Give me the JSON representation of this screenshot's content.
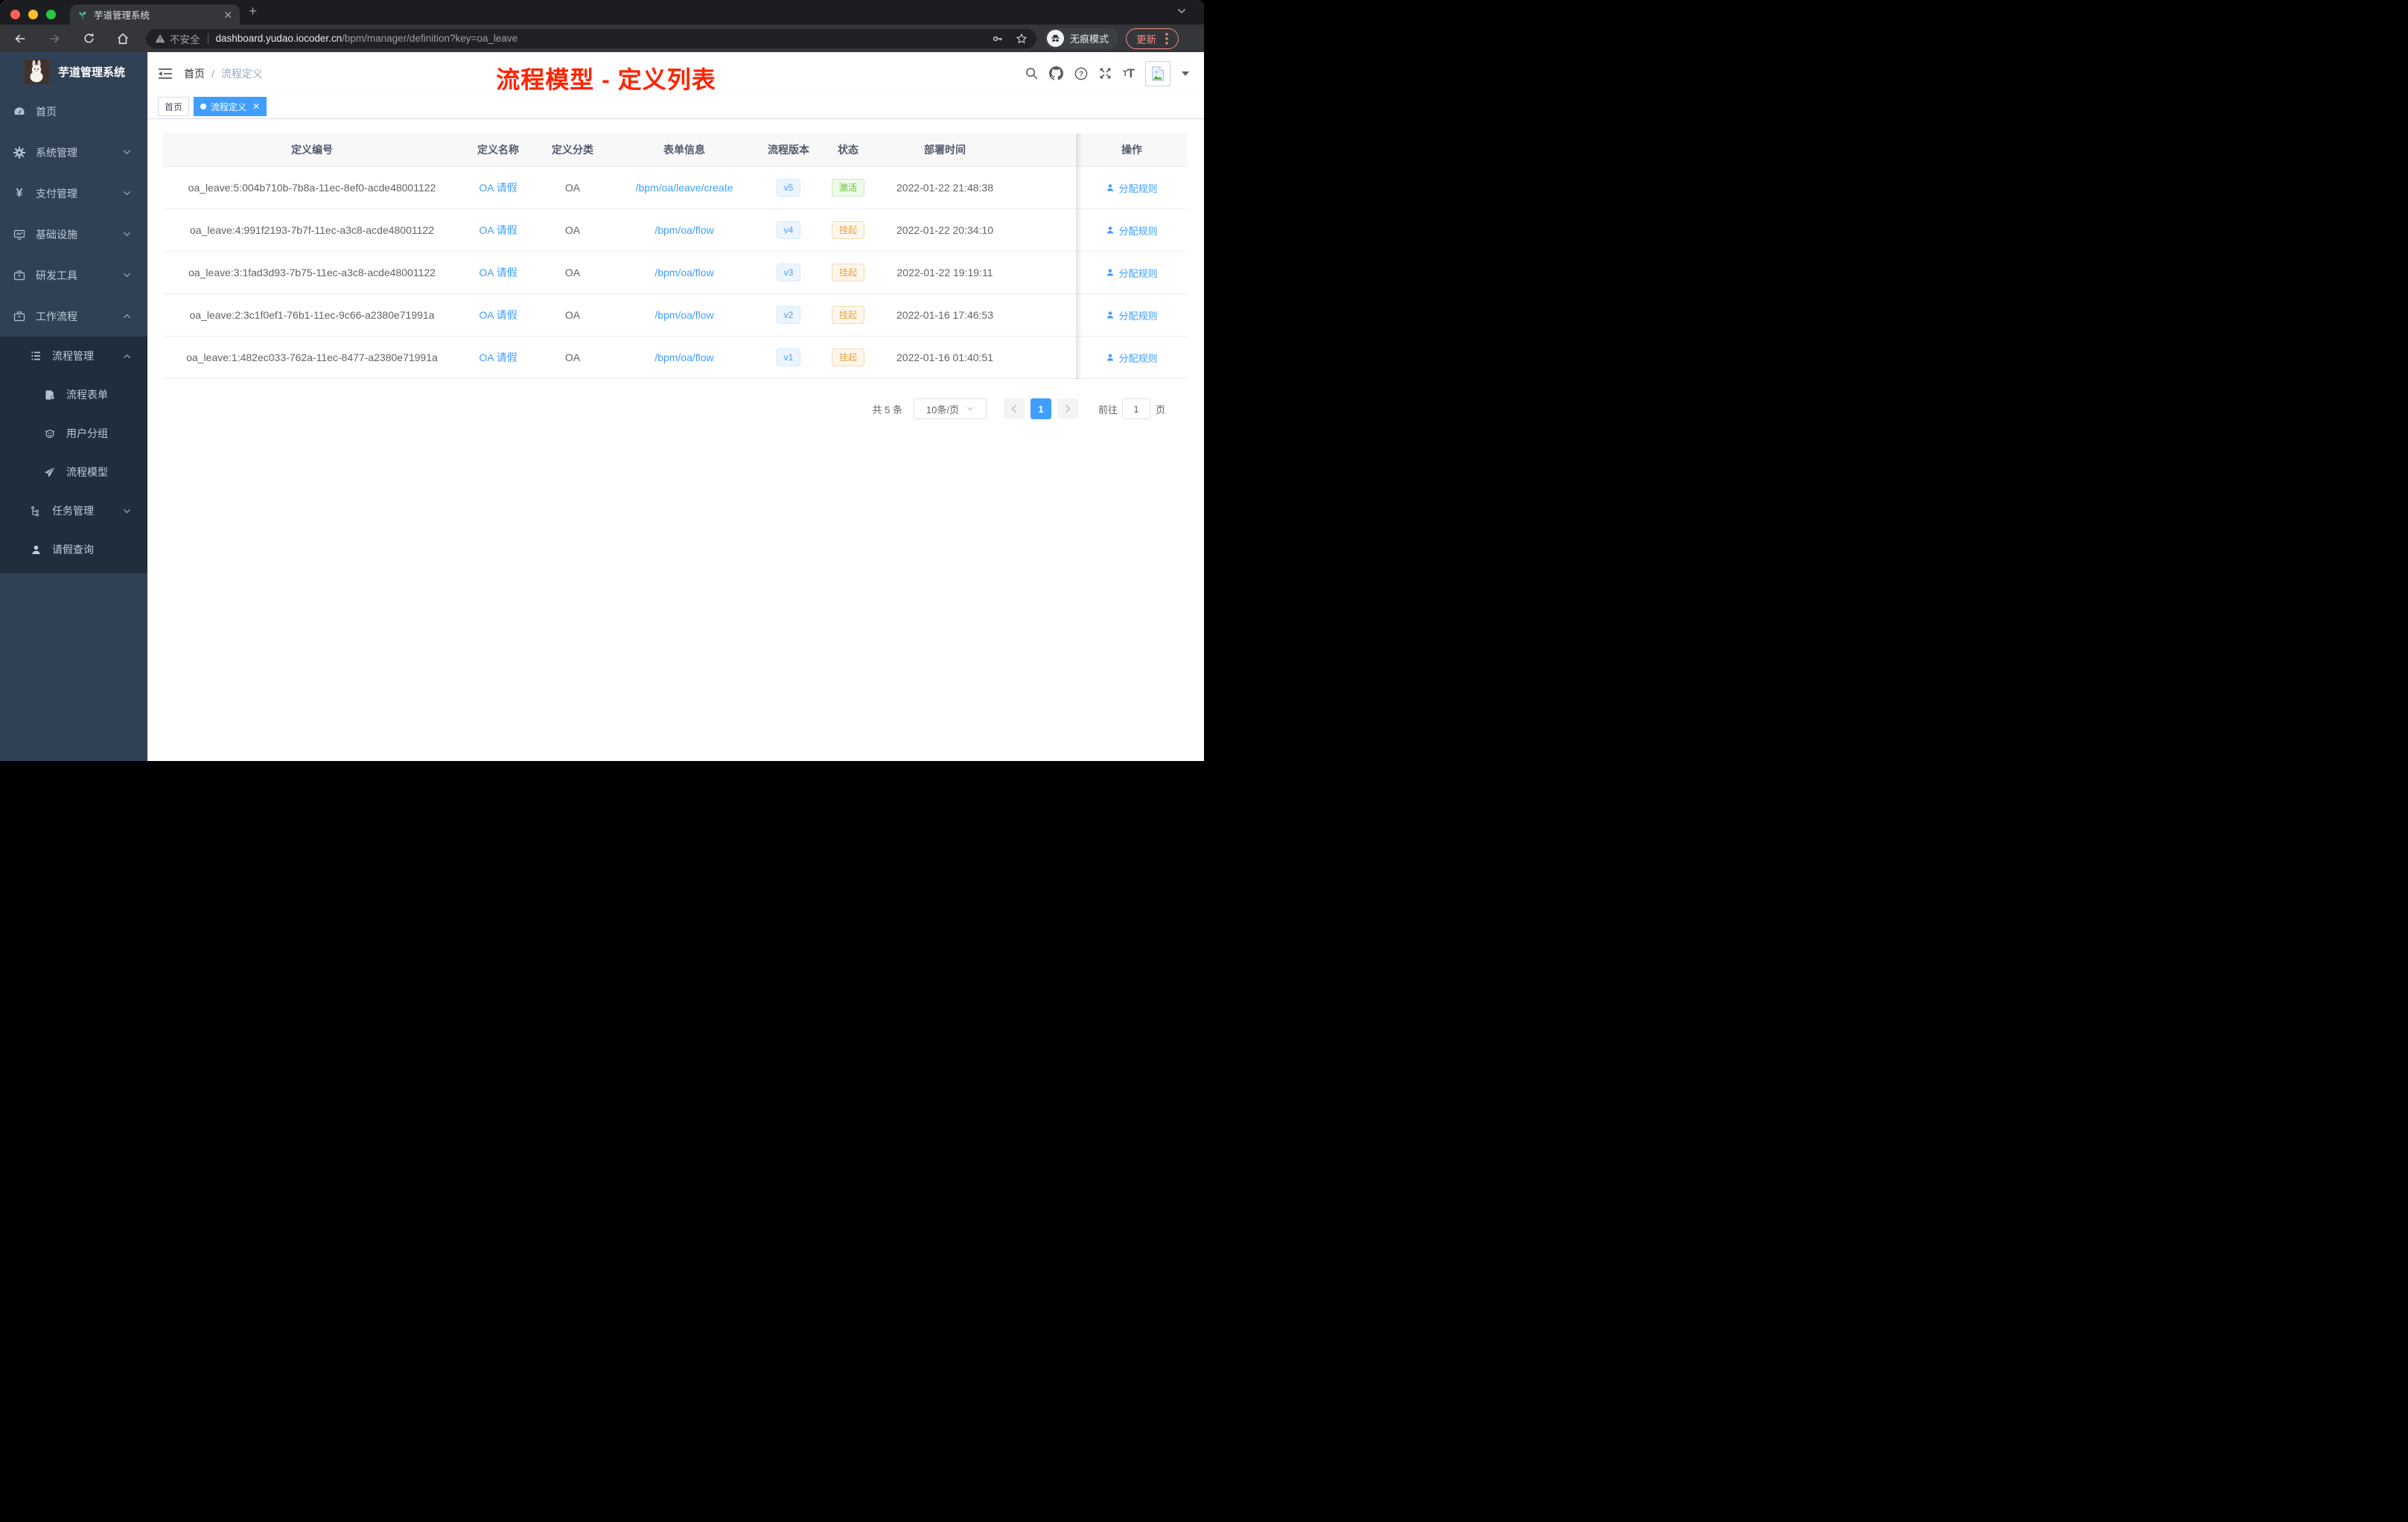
{
  "colors": {
    "accent_blue": "#409eff",
    "success_green": "#67c23a",
    "warning_orange": "#e6a23c",
    "annotation_red": "#ff2200",
    "sidebar_bg": "#304156",
    "submenu_bg": "#1f2d3d",
    "chrome_update_red": "#f28b82",
    "traffic_lights": [
      "#ff5f57",
      "#febc2e",
      "#28c840"
    ]
  },
  "browser": {
    "tab_title": "芋道管理系统",
    "security_label": "不安全",
    "url_host": "dashboard.yudao.iocoder.cn",
    "url_path": "/bpm/manager/definition?key=oa_leave",
    "incognito_label": "无痕模式",
    "update_label": "更新"
  },
  "sidebar": {
    "logo_title": "芋道管理系统",
    "items": [
      {
        "label": "首页",
        "icon": "dashboard-icon"
      },
      {
        "label": "系统管理",
        "icon": "gear-icon",
        "expand": "down"
      },
      {
        "label": "支付管理",
        "icon": "yen-icon",
        "expand": "down",
        "glyph": "¥"
      },
      {
        "label": "基础设施",
        "icon": "monitor-icon",
        "expand": "down"
      },
      {
        "label": "研发工具",
        "icon": "briefcase-icon",
        "expand": "down"
      },
      {
        "label": "工作流程",
        "icon": "briefcase-icon",
        "expand": "up"
      }
    ],
    "submenu": [
      {
        "label": "流程管理",
        "icon": "tree-table-icon",
        "expand": "up",
        "level": 2
      },
      {
        "label": "流程表单",
        "icon": "form-icon",
        "level": 3
      },
      {
        "label": "用户分组",
        "icon": "robot-icon",
        "level": 3
      },
      {
        "label": "流程模型",
        "icon": "paper-plane-icon",
        "level": 3
      },
      {
        "label": "任务管理",
        "icon": "flow-tree-icon",
        "expand": "down",
        "level": 2
      },
      {
        "label": "请假查询",
        "icon": "user-icon",
        "level": 2
      }
    ]
  },
  "header": {
    "breadcrumb": {
      "home": "首页",
      "separator": "/",
      "current": "流程定义"
    },
    "annotation": "流程模型 - 定义列表"
  },
  "tags": {
    "home": "首页",
    "active": "流程定义"
  },
  "table": {
    "columns": [
      "定义编号",
      "定义名称",
      "定义分类",
      "表单信息",
      "流程版本",
      "状态",
      "部署时间",
      "操作"
    ],
    "rows": [
      {
        "id": "oa_leave:5:004b710b-7b8a-11ec-8ef0-acde48001122",
        "name": "OA 请假",
        "category": "OA",
        "form": "/bpm/oa/leave/create",
        "version": "v5",
        "status": "激活",
        "status_type": "success",
        "deploy_time": "2022-01-22 21:48:38",
        "action": "分配规则"
      },
      {
        "id": "oa_leave:4:991f2193-7b7f-11ec-a3c8-acde48001122",
        "name": "OA 请假",
        "category": "OA",
        "form": "/bpm/oa/flow",
        "version": "v4",
        "status": "挂起",
        "status_type": "warning",
        "deploy_time": "2022-01-22 20:34:10",
        "action": "分配规则"
      },
      {
        "id": "oa_leave:3:1fad3d93-7b75-11ec-a3c8-acde48001122",
        "name": "OA 请假",
        "category": "OA",
        "form": "/bpm/oa/flow",
        "version": "v3",
        "status": "挂起",
        "status_type": "warning",
        "deploy_time": "2022-01-22 19:19:11",
        "action": "分配规则"
      },
      {
        "id": "oa_leave:2:3c1f0ef1-76b1-11ec-9c66-a2380e71991a",
        "name": "OA 请假",
        "category": "OA",
        "form": "/bpm/oa/flow",
        "version": "v2",
        "status": "挂起",
        "status_type": "warning",
        "deploy_time": "2022-01-16 17:46:53",
        "action": "分配规则"
      },
      {
        "id": "oa_leave:1:482ec033-762a-11ec-8477-a2380e71991a",
        "name": "OA 请假",
        "category": "OA",
        "form": "/bpm/oa/flow",
        "version": "v1",
        "status": "挂起",
        "status_type": "warning",
        "deploy_time": "2022-01-16 01:40:51",
        "action": "分配规则"
      }
    ]
  },
  "pagination": {
    "total": "共 5 条",
    "page_size": "10条/页",
    "current_page": "1",
    "goto_label": "前往",
    "goto_value": "1",
    "page_unit": "页"
  }
}
